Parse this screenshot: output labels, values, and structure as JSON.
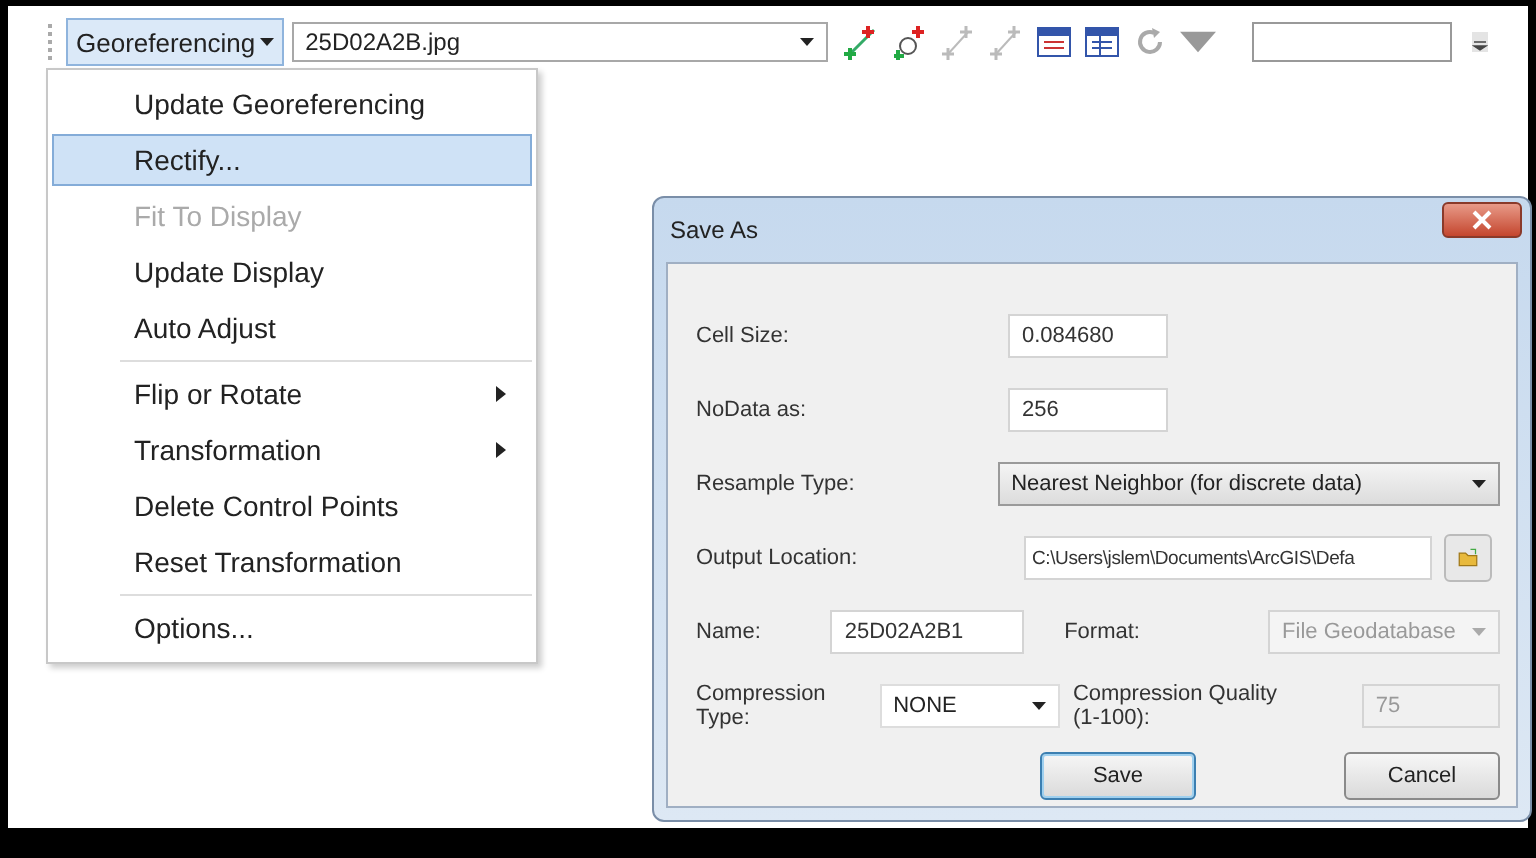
{
  "toolbar": {
    "menu_button": {
      "label": "Georeferencing",
      "expanded": true
    },
    "layer_combo": {
      "value": "25D02A2B.jpg"
    }
  },
  "menu": {
    "items": [
      {
        "kind": "item",
        "label": "Update Georeferencing",
        "selected": false,
        "disabled": false,
        "submenu": false
      },
      {
        "kind": "item",
        "label": "Rectify...",
        "selected": true,
        "disabled": false,
        "submenu": false
      },
      {
        "kind": "item",
        "label": "Fit To Display",
        "selected": false,
        "disabled": true,
        "submenu": false
      },
      {
        "kind": "item",
        "label": "Update Display",
        "selected": false,
        "disabled": false,
        "submenu": false
      },
      {
        "kind": "item",
        "label": "Auto Adjust",
        "selected": false,
        "disabled": false,
        "submenu": false
      },
      {
        "kind": "separator"
      },
      {
        "kind": "item",
        "label": "Flip or Rotate",
        "selected": false,
        "disabled": false,
        "submenu": true
      },
      {
        "kind": "item",
        "label": "Transformation",
        "selected": false,
        "disabled": false,
        "submenu": true
      },
      {
        "kind": "item",
        "label": "Delete Control Points",
        "selected": false,
        "disabled": false,
        "submenu": false
      },
      {
        "kind": "item",
        "label": "Reset Transformation",
        "selected": false,
        "disabled": false,
        "submenu": false
      },
      {
        "kind": "separator"
      },
      {
        "kind": "item",
        "label": "Options...",
        "selected": false,
        "disabled": false,
        "submenu": false
      }
    ]
  },
  "dialog": {
    "title": "Save As",
    "cell_size": {
      "label": "Cell Size:",
      "value": "0.084680"
    },
    "nodata": {
      "label": "NoData as:",
      "value": "256"
    },
    "resample": {
      "label": "Resample Type:",
      "value": "Nearest Neighbor (for discrete data)"
    },
    "output_location": {
      "label": "Output Location:",
      "value": "C:\\Users\\jslem\\Documents\\ArcGIS\\Defa"
    },
    "name": {
      "label": "Name:",
      "value": "25D02A2B1"
    },
    "format": {
      "label": "Format:",
      "value": "File Geodatabase",
      "disabled": true
    },
    "compression_type": {
      "label": "Compression Type:",
      "value": "NONE"
    },
    "compression_quality": {
      "label": "Compression Quality (1-100):",
      "value": "75",
      "disabled": true
    },
    "buttons": [
      {
        "label": "Save",
        "default": true
      },
      {
        "label": "Cancel",
        "default": false
      }
    ]
  }
}
